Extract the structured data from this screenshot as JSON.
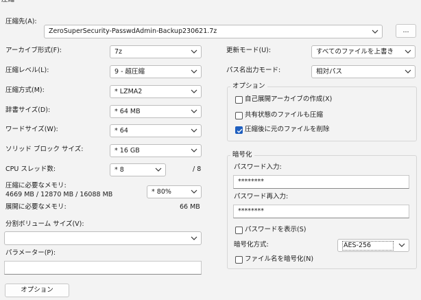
{
  "window": {
    "title": "圧縮"
  },
  "archive": {
    "label": "圧縮先(A):",
    "path": "ZeroSuperSecurity-PasswdAdmin-Backup230621.7z",
    "browse_label": "..."
  },
  "left": {
    "format": {
      "label": "アーカイブ形式(F):",
      "value": "7z"
    },
    "level": {
      "label": "圧縮レベル(L):",
      "value": "9 - 超圧縮"
    },
    "method": {
      "label": "圧縮方式(M):",
      "value": "* LZMA2"
    },
    "dict": {
      "label": "辞書サイズ(D):",
      "value": "* 64 MB"
    },
    "word": {
      "label": "ワードサイズ(W):",
      "value": "* 64"
    },
    "solid": {
      "label": "ソリッド ブロック サイズ:",
      "value": "* 16 GB"
    },
    "threads": {
      "label": "CPU スレッド数:",
      "value": "* 8",
      "max": "/ 8"
    },
    "mem_compress": {
      "label": "圧縮に必要なメモリ:",
      "detail": "4669 MB / 12870 MB / 16088 MB",
      "value": "* 80%"
    },
    "mem_decompress": {
      "label": "展開に必要なメモリ:",
      "value": "66 MB"
    },
    "split": {
      "label": "分割ボリューム サイズ(V):",
      "value": ""
    },
    "params": {
      "label": "パラメーター(P):",
      "value": ""
    },
    "options_button": "オプション"
  },
  "right": {
    "update_mode": {
      "label": "更新モード(U):",
      "value": "すべてのファイルを上書き"
    },
    "path_mode": {
      "label": "パス名出力モード:",
      "value": "相対パス"
    },
    "options_group": {
      "title": "オプション",
      "sfx": {
        "label": "自己展開アーカイブの作成(X)",
        "checked": false
      },
      "shared": {
        "label": "共有状態のファイルも圧縮",
        "checked": false
      },
      "delete": {
        "label": "圧縮後に元のファイルを削除",
        "checked": true
      }
    },
    "encryption": {
      "title": "暗号化",
      "pw_label": "パスワード入力:",
      "pw_value": "********",
      "pw2_label": "パスワード再入力:",
      "pw2_value": "********",
      "show_pw": {
        "label": "パスワードを表示(S)",
        "checked": false
      },
      "method_label": "暗号化方式:",
      "method_value": "AES-256",
      "encrypt_names": {
        "label": "ファイル名を暗号化(N)",
        "checked": false
      }
    }
  }
}
